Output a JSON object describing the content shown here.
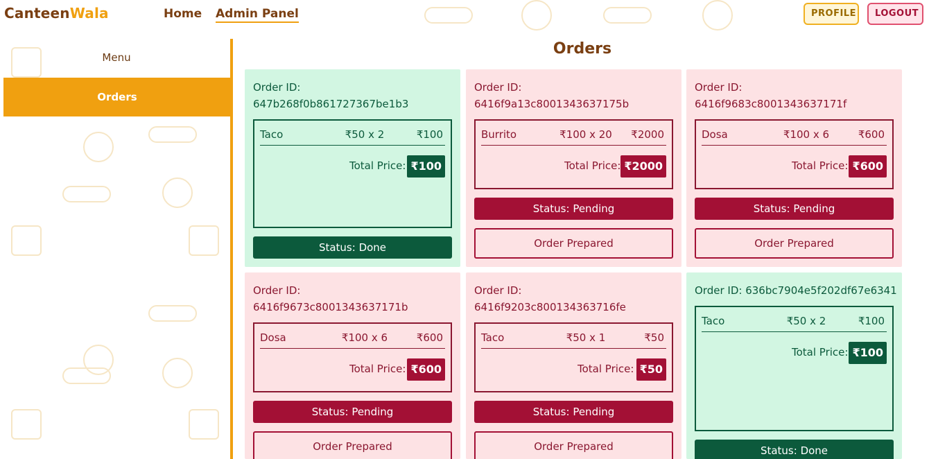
{
  "app": {
    "brand_part1": "Canteen",
    "brand_part2": "Wala",
    "brand_color_primary": "#7a3f12",
    "brand_color_accent": "#f0a010"
  },
  "nav": {
    "home_label": "Home",
    "admin_label": "Admin Panel",
    "profile_label": "PROFILE",
    "logout_label": "LOGOUT"
  },
  "sidebar": {
    "items": [
      {
        "label": "Menu",
        "active": false
      },
      {
        "label": "Orders",
        "active": true
      }
    ]
  },
  "main": {
    "title": "Orders"
  },
  "colors": {
    "done_bg": "#d2f6e2",
    "done_accent": "#0c5a3c",
    "pending_bg": "#fde2e4",
    "pending_accent": "#a31035"
  },
  "orders": [
    {
      "order_id_label": "Order ID:",
      "order_id": "647b268f0b861727367be1b3",
      "status": "done",
      "item": {
        "name": "Taco",
        "qty": "₹50 x 2",
        "total": "₹100"
      },
      "total_label": "Total Price:",
      "total_price": "₹100",
      "status_label": "Status: Done",
      "action_label": ""
    },
    {
      "order_id_label": "Order ID:",
      "order_id": "6416f9a13c8001343637175b",
      "status": "pending",
      "item": {
        "name": "Burrito",
        "qty": "₹100 x 20",
        "total": "₹2000"
      },
      "total_label": "Total Price:",
      "total_price": "₹2000",
      "status_label": "Status: Pending",
      "action_label": "Order Prepared"
    },
    {
      "order_id_label": "Order ID:",
      "order_id": "6416f9683c8001343637171f",
      "status": "pending",
      "item": {
        "name": "Dosa",
        "qty": "₹100 x 6",
        "total": "₹600"
      },
      "total_label": "Total Price:",
      "total_price": "₹600",
      "status_label": "Status: Pending",
      "action_label": "Order Prepared"
    },
    {
      "order_id_label": "Order ID:",
      "order_id": "6416f9673c8001343637171b",
      "status": "pending",
      "item": {
        "name": "Dosa",
        "qty": "₹100 x 6",
        "total": "₹600"
      },
      "total_label": "Total Price:",
      "total_price": "₹600",
      "status_label": "Status: Pending",
      "action_label": "Order Prepared"
    },
    {
      "order_id_label": "Order ID:",
      "order_id": "6416f9203c800134363716fe",
      "status": "pending",
      "item": {
        "name": "Taco",
        "qty": "₹50 x 1",
        "total": "₹50"
      },
      "total_label": "Total Price:",
      "total_price": "₹50",
      "status_label": "Status: Pending",
      "action_label": "Order Prepared"
    },
    {
      "order_id_label": "Order ID:",
      "order_id": "636bc7904e5f202df67e6341",
      "status": "done",
      "item": {
        "name": "Taco",
        "qty": "₹50 x 2",
        "total": "₹100"
      },
      "total_label": "Total Price:",
      "total_price": "₹100",
      "status_label": "Status: Done",
      "action_label": ""
    }
  ]
}
